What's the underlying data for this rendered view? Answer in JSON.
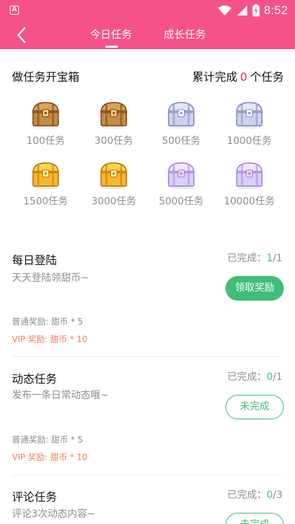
{
  "status_bar": {
    "time": "8:52",
    "app_badge": "A"
  },
  "header": {
    "tabs": [
      {
        "label": "今日任务",
        "active": true
      },
      {
        "label": "成长任务",
        "active": false
      }
    ]
  },
  "treasure": {
    "title": "做任务开宝箱",
    "count_prefix": "累计完成",
    "count_value": "0",
    "count_suffix": "个任务",
    "chests": [
      {
        "label": "100任务",
        "kind": "bronze"
      },
      {
        "label": "300任务",
        "kind": "bronze"
      },
      {
        "label": "500任务",
        "kind": "silver"
      },
      {
        "label": "1000任务",
        "kind": "silver"
      },
      {
        "label": "1500任务",
        "kind": "gold"
      },
      {
        "label": "3000任务",
        "kind": "gold"
      },
      {
        "label": "5000任务",
        "kind": "diamond"
      },
      {
        "label": "10000任务",
        "kind": "diamond"
      }
    ]
  },
  "tasks": [
    {
      "name": "每日登陆",
      "desc": "天天登陆领甜币~",
      "progress_label": "已完成：",
      "progress_done": "1",
      "progress_total": "/1",
      "normal_reward": "普通奖励:   甜币 * 5",
      "vip_reward": "VIP 奖励:   甜币 * 10",
      "button": "领取奖励",
      "button_state": "claim"
    },
    {
      "name": "动态任务",
      "desc": "发布一条日常动态哦~",
      "progress_label": "已完成：",
      "progress_done": "0",
      "progress_total": "/1",
      "normal_reward": "普通奖励:   甜币 * 5",
      "vip_reward": "VIP 奖励:   甜币 * 10",
      "button": "未完成",
      "button_state": "pending"
    },
    {
      "name": "评论任务",
      "desc": "评论3次动态内容~",
      "progress_label": "已完成：",
      "progress_done": "0",
      "progress_total": "/3",
      "button": "未完成",
      "button_state": "pending"
    }
  ],
  "colors": {
    "brand_pink": "#f5528a",
    "green": "#3fbf78",
    "count_red": "#f0264b",
    "vip_orange": "#f08059"
  },
  "icons": [
    "back-arrow-icon",
    "wifi-icon",
    "signal-icon",
    "battery-icon",
    "treasure-chest-icon"
  ]
}
